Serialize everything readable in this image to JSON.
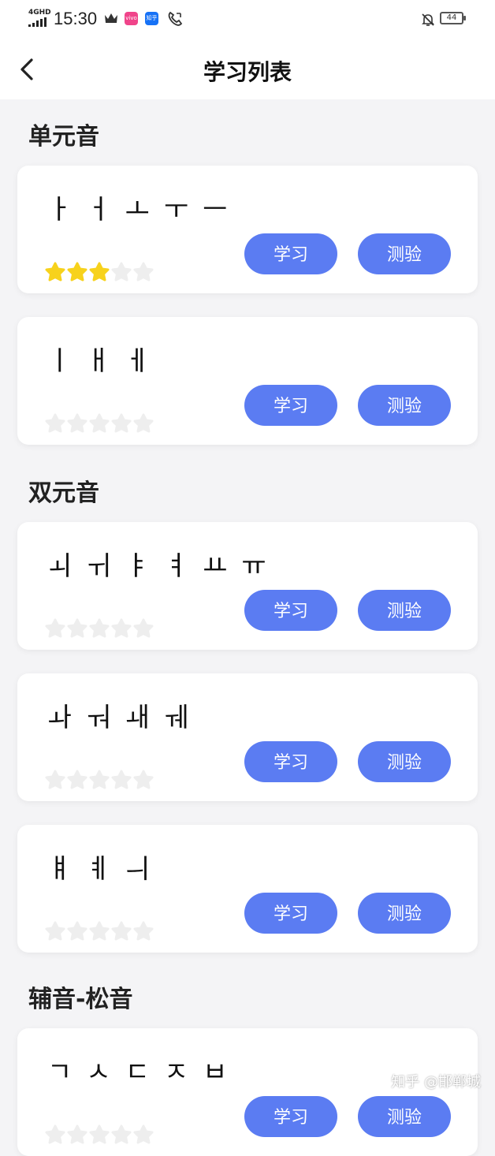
{
  "status_bar": {
    "network": "4GHD",
    "time": "15:30",
    "battery": "44",
    "app_icon_1": "vivo",
    "app_icon_2": "知乎"
  },
  "nav": {
    "title": "学习列表",
    "back_icon": "chevron-left-icon"
  },
  "colors": {
    "button": "#5b7cf2",
    "star_filled": "#f7d21c",
    "star_empty": "#eeeeee",
    "page_bg": "#f4f4f6"
  },
  "sections": [
    {
      "title": "单元音",
      "cards": [
        {
          "letters": [
            "ㅏ",
            "ㅓ",
            "ㅗ",
            "ㅜ",
            "ㅡ"
          ],
          "learn_label": "学习",
          "quiz_label": "测验",
          "stars_filled": 3,
          "stars_total": 5
        },
        {
          "letters": [
            "ㅣ",
            "ㅐ",
            "ㅔ"
          ],
          "learn_label": "学习",
          "quiz_label": "测验",
          "stars_filled": 0,
          "stars_total": 5
        }
      ]
    },
    {
      "title": "双元音",
      "cards": [
        {
          "letters": [
            "ㅚ",
            "ㅟ",
            "ㅑ",
            "ㅕ",
            "ㅛ",
            "ㅠ"
          ],
          "learn_label": "学习",
          "quiz_label": "测验",
          "stars_filled": 0,
          "stars_total": 5
        },
        {
          "letters": [
            "ㅘ",
            "ㅝ",
            "ㅙ",
            "ㅞ"
          ],
          "learn_label": "学习",
          "quiz_label": "测验",
          "stars_filled": 0,
          "stars_total": 5
        },
        {
          "letters": [
            "ㅒ",
            "ㅖ",
            "ㅢ"
          ],
          "learn_label": "学习",
          "quiz_label": "测验",
          "stars_filled": 0,
          "stars_total": 5
        }
      ]
    },
    {
      "title": "辅音-松音",
      "cards": [
        {
          "letters": [
            "ㄱ",
            "ㅅ",
            "ㄷ",
            "ㅈ",
            "ㅂ"
          ],
          "learn_label": "学习",
          "quiz_label": "测验",
          "stars_filled": 0,
          "stars_total": 5
        }
      ]
    }
  ],
  "watermark": "知乎 @邯郸城"
}
